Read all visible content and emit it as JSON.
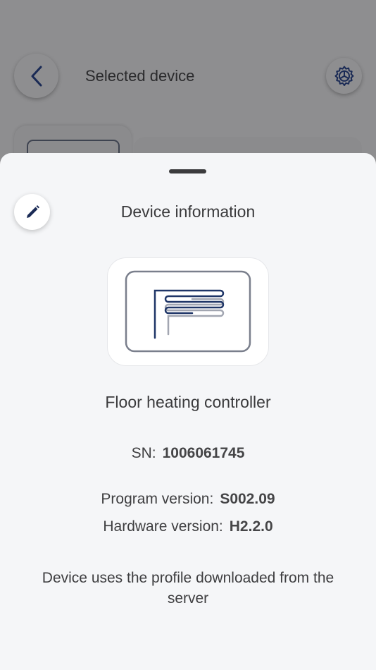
{
  "background": {
    "title": "Selected device",
    "back_icon": "chevron-left-icon",
    "settings_icon": "gear-icon"
  },
  "sheet": {
    "title": "Device information",
    "edit_icon": "pencil-icon",
    "device_icon": "floor-heating-icon",
    "device_name": "Floor heating controller",
    "sn_label": "SN:",
    "sn_value": "1006061745",
    "program_label": "Program version:",
    "program_value": "S002.09",
    "hardware_label": "Hardware version:",
    "hardware_value": "H2.2.0",
    "note": "Device uses the profile downloaded from the server"
  },
  "colors": {
    "accent": "#1f3567",
    "sheet_bg": "#f5f6f8",
    "overlay": "#8e8e90"
  }
}
